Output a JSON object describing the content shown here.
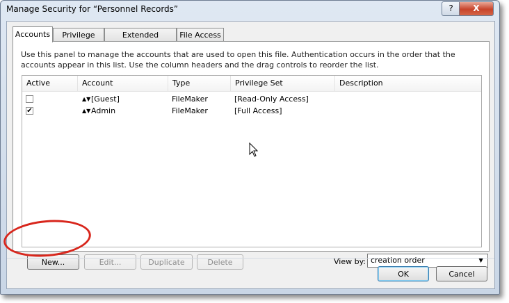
{
  "window": {
    "title": "Manage Security for “Personnel Records”",
    "help_label": "?",
    "close_label": "X"
  },
  "tabs": [
    {
      "label": "Accounts",
      "active": true
    },
    {
      "label": "Privilege Sets",
      "active": false
    },
    {
      "label": "Extended Privileges",
      "active": false
    },
    {
      "label": "File Access",
      "active": false
    }
  ],
  "description": "Use this panel to manage the accounts that are used to open this file. Authentication occurs in the order that the accounts appear in this list. Use the column headers and the drag controls to reorder the list.",
  "columns": [
    "Active",
    "Account",
    "Type",
    "Privilege Set",
    "Description"
  ],
  "rows": [
    {
      "active": false,
      "active_mark": "",
      "drag": "▲▼",
      "account": "[Guest]",
      "type": "FileMaker",
      "privilege_set": "[Read-Only Access]",
      "description": ""
    },
    {
      "active": true,
      "active_mark": "✔",
      "drag": "▲▼",
      "account": "Admin",
      "type": "FileMaker",
      "privilege_set": "[Full Access]",
      "description": ""
    }
  ],
  "buttons": {
    "new": "New...",
    "edit": "Edit...",
    "duplicate": "Duplicate",
    "delete": "Delete",
    "ok": "OK",
    "cancel": "Cancel"
  },
  "view_by": {
    "label": "View by:",
    "selected": "creation order",
    "arrow": "▼"
  },
  "colors": {
    "highlight_ellipse": "#d8261c",
    "close_button": "#c7442b"
  }
}
